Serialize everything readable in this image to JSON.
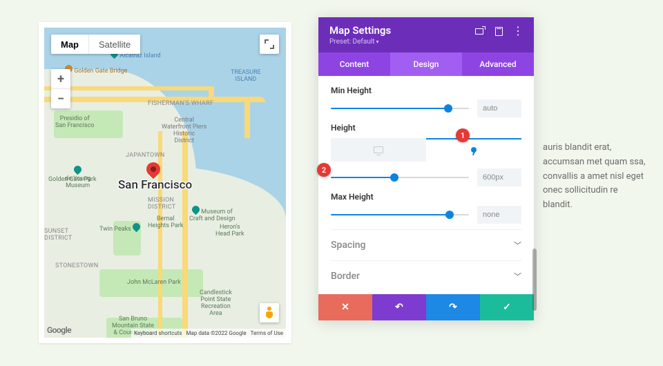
{
  "map": {
    "type_buttons": {
      "map": "Map",
      "satellite": "Satellite"
    },
    "zoom": {
      "in": "+",
      "out": "−"
    },
    "city": "San Francisco",
    "pois": {
      "alcatraz": "Alcatraz Island",
      "treasure": "TREASURE\nISLAND",
      "golden_gate": "Golden Gate Bridge",
      "presidio": "Presidio of\nSan Francisco",
      "ggpark": "Golden Gate Park",
      "japantown": "JAPANTOWN",
      "mission": "MISSION\nDISTRICT",
      "sunset": "SUNSET\nDISTRICT",
      "stonestown": "STONESTOWN",
      "fishermans": "FISHERMAN'S\nWHARF",
      "central_piers": "Central\nWaterfront Piers\nHistoric\nDistrict",
      "young": "de Young\nMuseum",
      "craft": "Museum of\nCraft and Design",
      "twin_peaks": "Twin Peaks",
      "bernal": "Bernal\nHeights Park",
      "heron": "Heron's\nHead Park",
      "mclaren": "John McLaren Park",
      "candlestick": "Candlestick\nPoint State\nRecreation\nArea",
      "sanbruno": "San Bruno\nMountain State\n& County Park"
    },
    "footer": {
      "shortcuts": "Keyboard shortcuts",
      "copyright": "Map data ©2022 Google",
      "terms": "Terms of Use"
    },
    "logo": "Google"
  },
  "bg_text": "auris blandit erat, accumsan met quam ssa, convallis a amet nisl eget onec sollicitudin re blandit.",
  "panel": {
    "title": "Map Settings",
    "preset": "Preset: Default",
    "tabs": {
      "content": "Content",
      "design": "Design",
      "advanced": "Advanced"
    },
    "settings": {
      "min_height": {
        "label": "Min Height",
        "value": "auto",
        "slider_pct": 85
      },
      "height": {
        "label": "Height",
        "value": "600px",
        "slider_pct": 46
      },
      "max_height": {
        "label": "Max Height",
        "value": "none",
        "slider_pct": 86
      }
    },
    "accordions": {
      "spacing": "Spacing",
      "border": "Border"
    },
    "footer_icons": {
      "close": "✕",
      "undo": "↶",
      "redo": "↷",
      "save": "✓"
    }
  },
  "hints": {
    "one": "1",
    "two": "2"
  }
}
